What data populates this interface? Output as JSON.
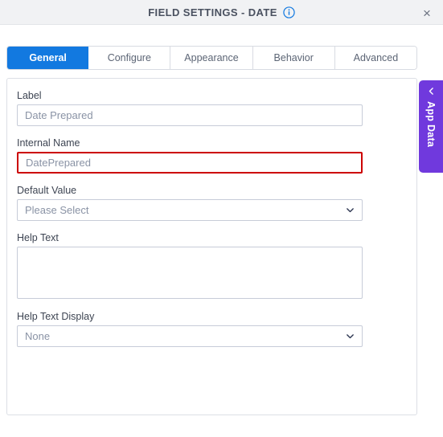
{
  "header": {
    "title": "FIELD SETTINGS - DATE",
    "info_icon": "info-circle-icon",
    "close_icon": "×"
  },
  "tabs": [
    {
      "label": "General",
      "active": true
    },
    {
      "label": "Configure",
      "active": false
    },
    {
      "label": "Appearance",
      "active": false
    },
    {
      "label": "Behavior",
      "active": false
    },
    {
      "label": "Advanced",
      "active": false
    }
  ],
  "form": {
    "label_field": {
      "label": "Label",
      "value": "Date Prepared"
    },
    "internal_name_field": {
      "label": "Internal Name",
      "value": "DatePrepared",
      "error": true
    },
    "default_value_field": {
      "label": "Default Value",
      "value": "Please Select"
    },
    "help_text_field": {
      "label": "Help Text",
      "value": ""
    },
    "help_text_display_field": {
      "label": "Help Text Display",
      "value": "None"
    }
  },
  "side_panel": {
    "label": "App Data",
    "collapse_icon": "chevron-left-icon"
  },
  "colors": {
    "accent": "#1279e0",
    "error": "#cc0000",
    "purple": "#7039dd",
    "header_bg": "#f1f2f4"
  }
}
